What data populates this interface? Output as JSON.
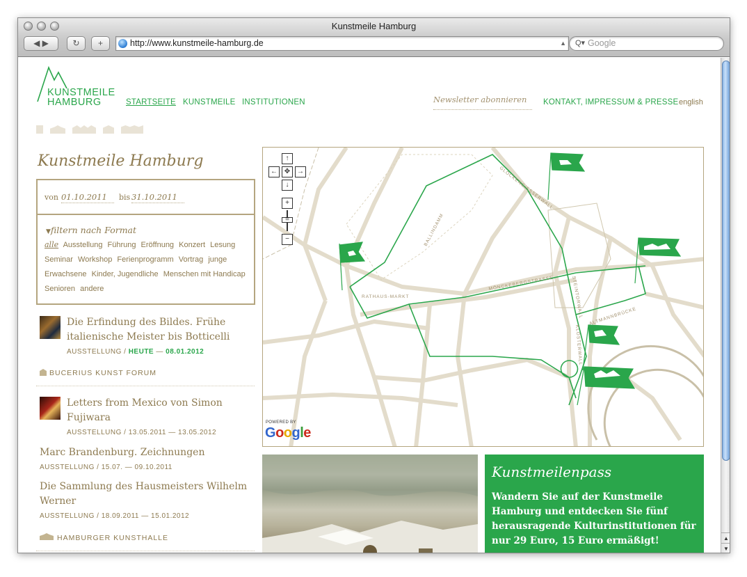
{
  "window": {
    "title": "Kunstmeile Hamburg"
  },
  "toolbar": {
    "url": "http://www.kunstmeile-hamburg.de",
    "search_placeholder": "Google"
  },
  "logo": {
    "line1": "KUNSTMEILE",
    "line2": "HAMBURG"
  },
  "nav": {
    "items": [
      "STARTSEITE",
      "KUNSTMEILE",
      "INSTITUTIONEN"
    ],
    "newsletter": "Newsletter abonnieren",
    "contact": "KONTAKT, IMPRESSUM & PRESSE",
    "language": "english"
  },
  "sidebar": {
    "title": "Kunstmeile Hamburg",
    "von_label": "von",
    "von_value": "01.10.2011",
    "bis_label": "bis",
    "bis_value": "31.10.2011",
    "filter_title": "filtern nach Format",
    "tags": [
      "alle",
      "Ausstellung",
      "Führung",
      "Eröffnung",
      "Konzert",
      "Lesung",
      "Seminar",
      "Workshop",
      "Ferienprogramm",
      "Vortrag",
      "junge Erwachsene",
      "Kinder, Jugendliche",
      "Menschen mit Handicap",
      "Senioren",
      "andere"
    ]
  },
  "events": [
    {
      "title": "Die Erfindung des Bildes. Frühe italienische Meister bis Botticelli",
      "type": "AUSSTELLUNG /",
      "highlight": "HEUTE",
      "dash": "—",
      "end": "08.01.2012"
    },
    {
      "venue": "BUCERIUS KUNST FORUM"
    },
    {
      "title": "Letters from Mexico von Simon Fujiwara",
      "meta": "AUSSTELLUNG / 13.05.2011 — 13.05.2012"
    },
    {
      "title": "Marc Brandenburg. Zeichnungen",
      "meta": "AUSSTELLUNG / 15.07. — 09.10.2011"
    },
    {
      "title": "Die Sammlung des Hausmeisters Wilhelm Werner",
      "meta": "AUSSTELLUNG / 18.09.2011 — 15.01.2012"
    },
    {
      "venue": "HAMBURGER KUNSTHALLE"
    }
  ],
  "map": {
    "streets": [
      "GLOCKENGIESSERWALL",
      "BALLINDAMM",
      "RATHAUS-MARKT",
      "MÖNCKEBERGSTRASSE",
      "STEINTORWALL",
      "ALTMANNBRÜCKE",
      "KLOSTERWALL"
    ],
    "powered": "POWERED BY",
    "google": "Google"
  },
  "promo": {
    "title": "Kunstmeilenpass",
    "body": "Wandern Sie auf der Kunstmeile Hamburg und entdecken Sie fünf herausragende Kulturinstitutionen für nur 29 Euro, 15 Euro ermäßigt!"
  },
  "colors": {
    "green": "#2aa64b",
    "brown": "#8d7a50",
    "beige": "#b4a57f"
  }
}
